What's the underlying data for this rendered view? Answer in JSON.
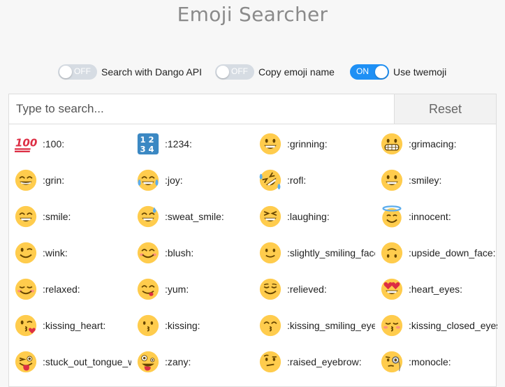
{
  "app": {
    "title": "Emoji Searcher"
  },
  "toggles": [
    {
      "state": "OFF",
      "on": false,
      "label": "Search with Dango API"
    },
    {
      "state": "OFF",
      "on": false,
      "label": "Copy emoji name"
    },
    {
      "state": "ON",
      "on": true,
      "label": "Use twemoji"
    }
  ],
  "search": {
    "placeholder": "Type to search...",
    "value": ""
  },
  "reset_label": "Reset",
  "colors": {
    "accent": "#1e90f5",
    "emoji_yellow": "#ffcc4d",
    "emoji_feature": "#664500"
  },
  "emojis": [
    {
      "name": ":100:",
      "icon": "hundred-points-icon"
    },
    {
      "name": ":1234:",
      "icon": "input-numbers-icon"
    },
    {
      "name": ":grinning:",
      "icon": "grinning-face-icon"
    },
    {
      "name": ":grimacing:",
      "icon": "grimacing-face-icon"
    },
    {
      "name": ":grin:",
      "icon": "grin-face-icon"
    },
    {
      "name": ":joy:",
      "icon": "joy-face-icon"
    },
    {
      "name": ":rofl:",
      "icon": "rofl-face-icon"
    },
    {
      "name": ":smiley:",
      "icon": "smiley-face-icon"
    },
    {
      "name": ":smile:",
      "icon": "smile-face-icon"
    },
    {
      "name": ":sweat_smile:",
      "icon": "sweat-smile-face-icon"
    },
    {
      "name": ":laughing:",
      "icon": "laughing-face-icon"
    },
    {
      "name": ":innocent:",
      "icon": "innocent-face-icon"
    },
    {
      "name": ":wink:",
      "icon": "wink-face-icon"
    },
    {
      "name": ":blush:",
      "icon": "blush-face-icon"
    },
    {
      "name": ":slightly_smiling_face:",
      "icon": "slightly-smiling-face-icon"
    },
    {
      "name": ":upside_down_face:",
      "icon": "upside-down-face-icon"
    },
    {
      "name": ":relaxed:",
      "icon": "relaxed-face-icon"
    },
    {
      "name": ":yum:",
      "icon": "yum-face-icon"
    },
    {
      "name": ":relieved:",
      "icon": "relieved-face-icon"
    },
    {
      "name": ":heart_eyes:",
      "icon": "heart-eyes-face-icon"
    },
    {
      "name": ":kissing_heart:",
      "icon": "kissing-heart-face-icon"
    },
    {
      "name": ":kissing:",
      "icon": "kissing-face-icon"
    },
    {
      "name": ":kissing_smiling_eyes:",
      "icon": "kissing-smiling-eyes-face-icon"
    },
    {
      "name": ":kissing_closed_eyes:",
      "icon": "kissing-closed-eyes-face-icon"
    },
    {
      "name": ":stuck_out_tongue_winking_eye:",
      "icon": "stuck-out-tongue-winking-eye-face-icon"
    },
    {
      "name": ":zany:",
      "icon": "zany-face-icon"
    },
    {
      "name": ":raised_eyebrow:",
      "icon": "raised-eyebrow-face-icon"
    },
    {
      "name": ":monocle:",
      "icon": "monocle-face-icon"
    }
  ]
}
